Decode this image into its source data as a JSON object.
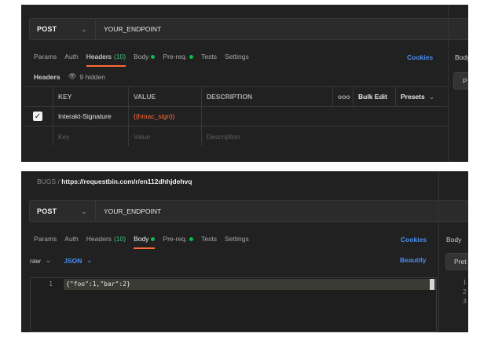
{
  "panel1": {
    "method": "POST",
    "url": "YOUR_ENDPOINT",
    "tabs": {
      "params": "Params",
      "auth": "Auth",
      "headers": "Headers",
      "headers_count": "(10)",
      "body": "Body",
      "prereq": "Pre-req.",
      "tests": "Tests",
      "settings": "Settings"
    },
    "cookies": "Cookies",
    "right_tab": "Body",
    "right_button": "P",
    "headers_label": "Headers",
    "hidden_text": "9 hidden",
    "table": {
      "columns": [
        "KEY",
        "VALUE",
        "DESCRIPTION"
      ],
      "more": "ooo",
      "bulk_edit": "Bulk Edit",
      "presets": "Presets",
      "rows": [
        {
          "key": "Interakt-Signature",
          "value": "{{hmac_sign}}",
          "description": ""
        }
      ],
      "placeholder": {
        "key": "Key",
        "value": "Value",
        "description": "Description"
      }
    }
  },
  "panel2": {
    "breadcrumb_parent": "BUGS",
    "breadcrumb_sep": "/",
    "breadcrumb_current": "https://requestbin.com/r/en112dhhjdehvq",
    "method": "POST",
    "url": "YOUR_ENDPOINT",
    "tabs": {
      "params": "Params",
      "auth": "Auth",
      "headers": "Headers",
      "headers_count": "(10)",
      "body": "Body",
      "prereq": "Pre-req.",
      "tests": "Tests",
      "settings": "Settings"
    },
    "cookies": "Cookies",
    "right_tab": "Body",
    "right_button": "Pret",
    "body_mode": "raw",
    "body_format": "JSON",
    "beautify": "Beautify",
    "editor": {
      "line_number": "1",
      "code": "{\"foo\":1,\"bar\":2}"
    },
    "right_line_numbers": [
      "1",
      "2",
      "3"
    ]
  },
  "colors": {
    "background": "#212121",
    "accent_orange": "#ff6c37",
    "link_blue": "#4a8ef0",
    "status_green": "#0cbb52"
  }
}
